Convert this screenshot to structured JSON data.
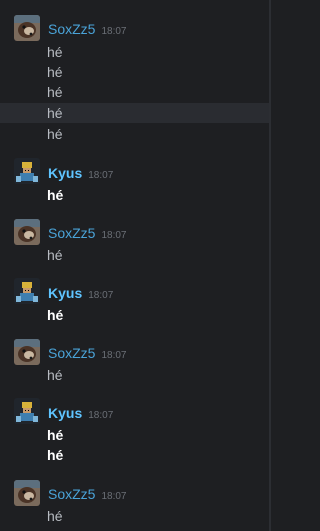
{
  "users": {
    "sox": {
      "name": "SoxZz5",
      "color": "#4aa3d8"
    },
    "kyus": {
      "name": "Kyus",
      "color": "#5fc4ff"
    }
  },
  "groups": [
    {
      "author": "SoxZz5",
      "time": "18:07",
      "messages": [
        "hé",
        "hé",
        "hé",
        "hé",
        "hé"
      ]
    },
    {
      "author": "Kyus",
      "time": "18:07",
      "messages": [
        "hé"
      ]
    },
    {
      "author": "SoxZz5",
      "time": "18:07",
      "messages": [
        "hé"
      ]
    },
    {
      "author": "Kyus",
      "time": "18:07",
      "messages": [
        "hé"
      ]
    },
    {
      "author": "SoxZz5",
      "time": "18:07",
      "messages": [
        "hé"
      ]
    },
    {
      "author": "Kyus",
      "time": "18:07",
      "messages": [
        "hé",
        "hé"
      ]
    },
    {
      "author": "SoxZz5",
      "time": "18:07",
      "messages": [
        "hé"
      ]
    }
  ]
}
